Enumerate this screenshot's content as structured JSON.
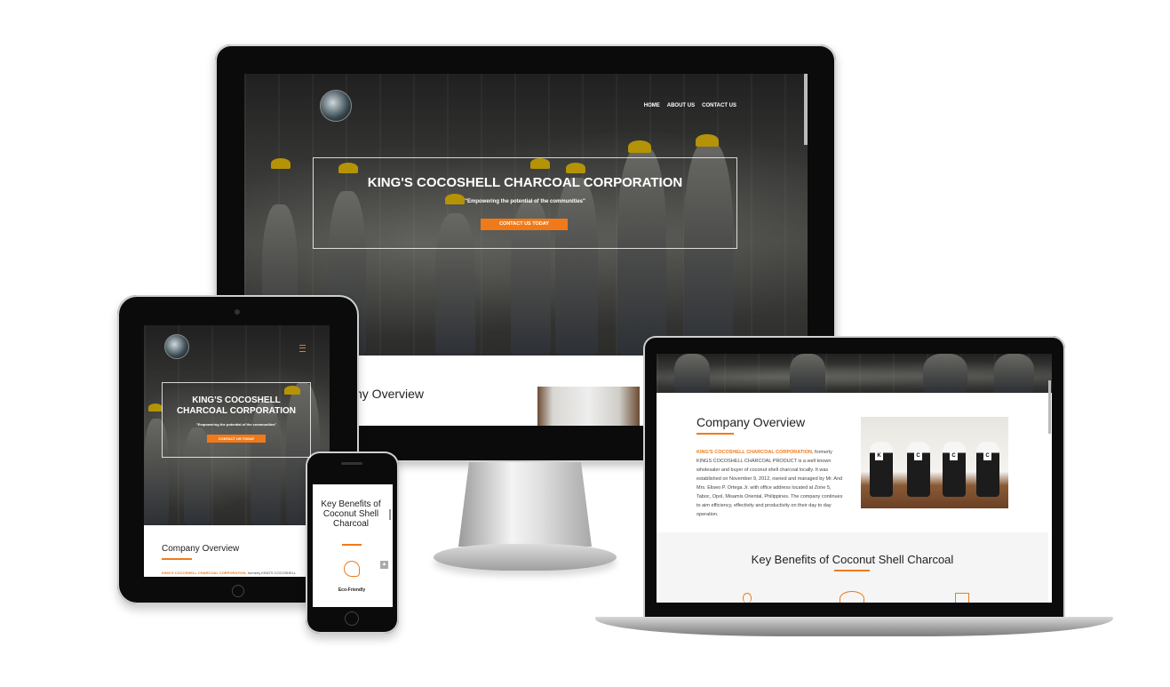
{
  "brand": {
    "accent": "#f07a1a",
    "helmet": "#f2c40a"
  },
  "desktop": {
    "nav": [
      "HOME",
      "ABOUT US",
      "CONTACT US"
    ],
    "hero_title": "KING'S COCOSHELL CHARCOAL CORPORATION",
    "hero_tagline": "\"Empowering the potential of the communities\"",
    "cta": "CONTACT US TODAY",
    "overview_partial": "ny Overview"
  },
  "tablet": {
    "hero_title_line1": "KING'S COCOSHELL",
    "hero_title_line2": "CHARCOAL CORPORATION",
    "hero_tagline": "\"Empowering the potential of the communities\"",
    "cta": "CONTACT US TODAY",
    "overview_title": "Company Overview",
    "overview_lead_highlight": "KING'S COCOSHELL CHARCOAL CORPORATION,",
    "overview_lead_rest": "formerly KING'S COCOSHELL"
  },
  "laptop": {
    "overview_title": "Company Overview",
    "overview_highlight": "KING'S COCOSHELL CHARCOAL CORPORATION,",
    "overview_body": "formerly KINGS COCOSHELL CHARCOAL PRODUCT is a well known wholesaler and buyer of coconut shell charcoal locally. It was established on November 9, 2012, owned and managed by Mr. And Mrs. Eliseo P. Ortega Jr. with office address located at Zone 5, Taboc, Opol, Misamis Oriental, Philippines. The company continues to aim efficiency, effectivity and productivity on their day to day operation.",
    "jar_labels": [
      "K",
      "C",
      "C",
      "C"
    ],
    "benefits_title": "Key Benefits of Coconut Shell Charcoal"
  },
  "phone": {
    "benefits_title": "Key Benefits of Coconut Shell Charcoal",
    "benefit_label": "Eco-Friendly"
  }
}
